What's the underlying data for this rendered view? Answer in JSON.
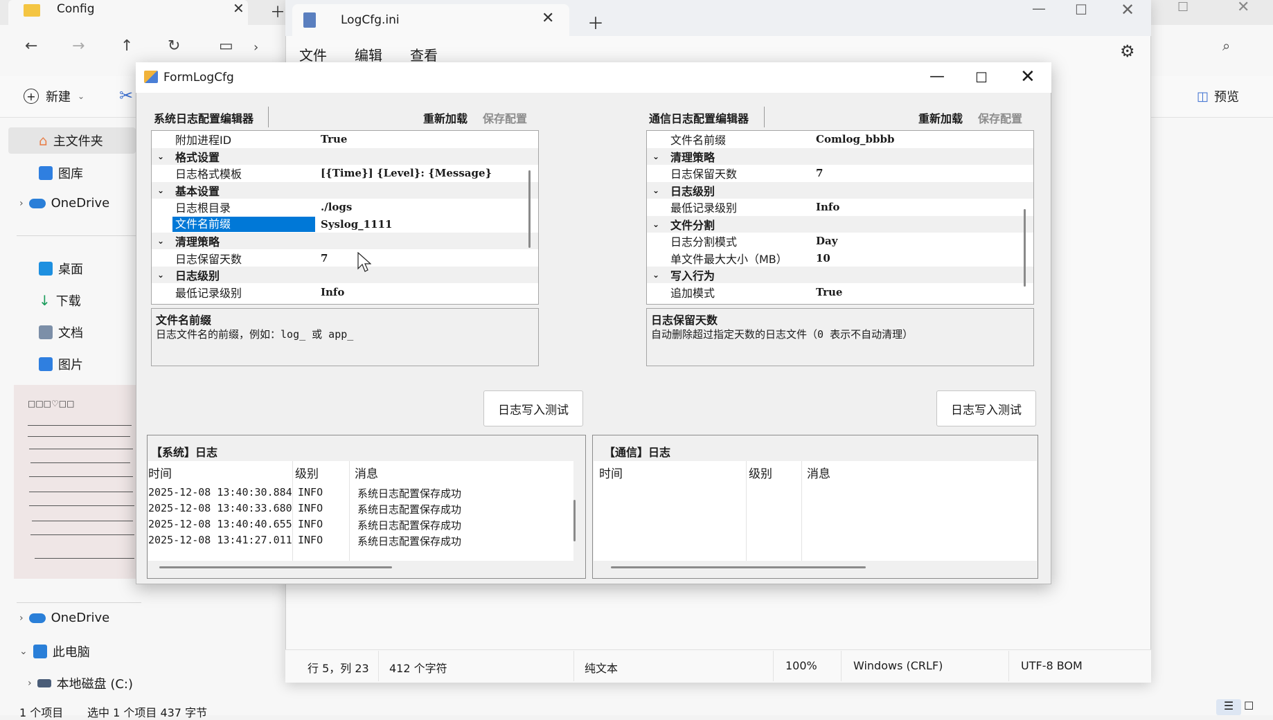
{
  "explorer": {
    "tab_title": "Config",
    "sidebar": {
      "home": "主文件夹",
      "gallery": "图库",
      "onedrive": "OneDrive",
      "desktop": "桌面",
      "downloads": "下载",
      "documents": "文档",
      "pictures": "图片",
      "onedrive2": "OneDrive",
      "this_pc": "此电脑",
      "local_disk": "本地磁盘 (C:)"
    },
    "toolbar": {
      "new_label": "新建",
      "preview_label": "预览"
    },
    "status": {
      "items": "1 个项目",
      "selected": "选中 1 个项目 437 字节"
    }
  },
  "notepad": {
    "tab_title": "LogCfg.ini",
    "menu": {
      "file": "文件",
      "edit": "编辑",
      "view": "查看"
    },
    "status": {
      "position": "行 5，列 23",
      "chars": "412 个字符",
      "format": "纯文本",
      "zoom": "100%",
      "eol": "Windows (CRLF)",
      "encoding": "UTF-8 BOM"
    }
  },
  "dialog": {
    "title": "FormLogCfg",
    "left": {
      "title": "系统日志配置编辑器",
      "reload": "重新加载",
      "save": "保存配置",
      "rows": [
        {
          "type": "prop",
          "key": "附加进程ID",
          "value": "True"
        },
        {
          "type": "cat",
          "key": "格式设置"
        },
        {
          "type": "prop",
          "key": "日志格式模板",
          "value": "[{Time}] {Level}: {Message}"
        },
        {
          "type": "cat",
          "key": "基本设置"
        },
        {
          "type": "prop",
          "key": "日志根目录",
          "value": "./logs"
        },
        {
          "type": "prop",
          "key": "文件名前缀",
          "value": "Syslog_1111",
          "selected": true
        },
        {
          "type": "cat",
          "key": "清理策略"
        },
        {
          "type": "prop",
          "key": "日志保留天数",
          "value": "7"
        },
        {
          "type": "cat",
          "key": "日志级别"
        },
        {
          "type": "prop",
          "key": "最低记录级别",
          "value": "Info"
        }
      ],
      "desc_title": "文件名前缀",
      "desc_text": "日志文件名的前缀，例如：log_ 或 app_",
      "test_button": "日志写入测试",
      "log": {
        "title": "【系统】日志",
        "columns": [
          "时间",
          "级别",
          "消息"
        ],
        "rows": [
          {
            "time": "2025-12-08 13:40:30.884",
            "level": "INFO",
            "msg": "系统日志配置保存成功"
          },
          {
            "time": "2025-12-08 13:40:33.680",
            "level": "INFO",
            "msg": "系统日志配置保存成功"
          },
          {
            "time": "2025-12-08 13:40:40.655",
            "level": "INFO",
            "msg": "系统日志配置保存成功"
          },
          {
            "time": "2025-12-08 13:41:27.011",
            "level": "INFO",
            "msg": "系统日志配置保存成功"
          }
        ]
      }
    },
    "right": {
      "title": "通信日志配置编辑器",
      "reload": "重新加载",
      "save": "保存配置",
      "rows": [
        {
          "type": "prop",
          "key": "文件名前缀",
          "value": "Comlog_bbbb"
        },
        {
          "type": "cat",
          "key": "清理策略"
        },
        {
          "type": "prop",
          "key": "日志保留天数",
          "value": "7"
        },
        {
          "type": "cat",
          "key": "日志级别"
        },
        {
          "type": "prop",
          "key": "最低记录级别",
          "value": "Info"
        },
        {
          "type": "cat",
          "key": "文件分割"
        },
        {
          "type": "prop",
          "key": "日志分割模式",
          "value": "Day"
        },
        {
          "type": "prop",
          "key": "单文件最大大小（MB）",
          "value": "10"
        },
        {
          "type": "cat",
          "key": "写入行为"
        },
        {
          "type": "prop",
          "key": "追加模式",
          "value": "True"
        }
      ],
      "desc_title": "日志保留天数",
      "desc_text": "自动删除超过指定天数的日志文件（0 表示不自动清理）",
      "test_button": "日志写入测试",
      "log": {
        "title": "【通信】日志",
        "columns": [
          "时间",
          "级别",
          "消息"
        ],
        "rows": []
      }
    }
  }
}
